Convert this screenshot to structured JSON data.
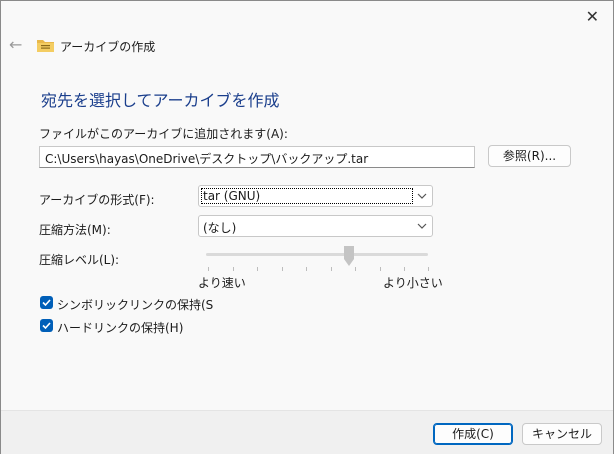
{
  "window": {
    "title": "アーカイブの作成",
    "close_glyph": "✕",
    "back_glyph": "←"
  },
  "heading": "宛先を選択してアーカイブを作成",
  "archive_path": {
    "label": "ファイルがこのアーカイブに追加されます(A):",
    "value": "C:\\Users\\hayas\\OneDrive\\デスクトップ\\バックアップ.tar",
    "browse_label": "参照(R)..."
  },
  "format": {
    "label": "アーカイブの形式(F):",
    "value": "tar (GNU)"
  },
  "compression_method": {
    "label": "圧縮方法(M):",
    "value": "(なし)"
  },
  "compression_level": {
    "label": "圧縮レベル(L):",
    "faster_label": "より速い",
    "smaller_label": "より小さい",
    "level_fraction": 0.67
  },
  "options": {
    "symlinks": {
      "label": "シンボリックリンクの保持(S",
      "checked": true
    },
    "hardlinks": {
      "label": "ハードリンクの保持(H)",
      "checked": true
    }
  },
  "footer": {
    "create_label": "作成(C)",
    "cancel_label": "キャンセル"
  },
  "colors": {
    "accent": "#005fb8",
    "heading": "#1a3e8c"
  }
}
